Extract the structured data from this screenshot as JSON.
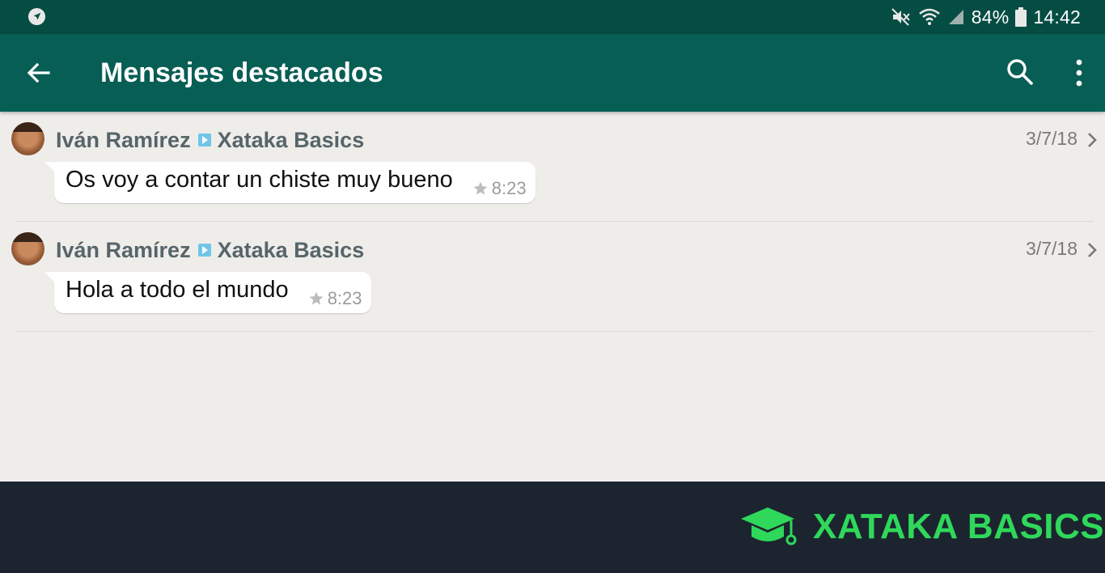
{
  "status_bar": {
    "battery_percent": "84%",
    "time": "14:42",
    "icons": [
      "navigation-icon",
      "mute-icon",
      "wifi-icon",
      "signal-icon",
      "battery-icon"
    ]
  },
  "app_bar": {
    "title": "Mensajes destacados",
    "icons": [
      "back-arrow-icon",
      "search-icon",
      "more-vert-icon"
    ]
  },
  "messages": [
    {
      "sender": "Iván Ramírez",
      "group": "Xataka Basics",
      "date": "3/7/18",
      "text": "Os voy a contar un chiste muy bueno",
      "time": "8:23"
    },
    {
      "sender": "Iván Ramírez",
      "group": "Xataka Basics",
      "date": "3/7/18",
      "text": "Hola a todo el mundo",
      "time": "8:23"
    }
  ],
  "footer": {
    "brand": "XATAKA BASICS"
  },
  "colors": {
    "status_bar": "#054d43",
    "app_bar": "#075e54",
    "background": "#efede9",
    "footer_bg": "#1c2430",
    "brand_green": "#2fd85a"
  }
}
